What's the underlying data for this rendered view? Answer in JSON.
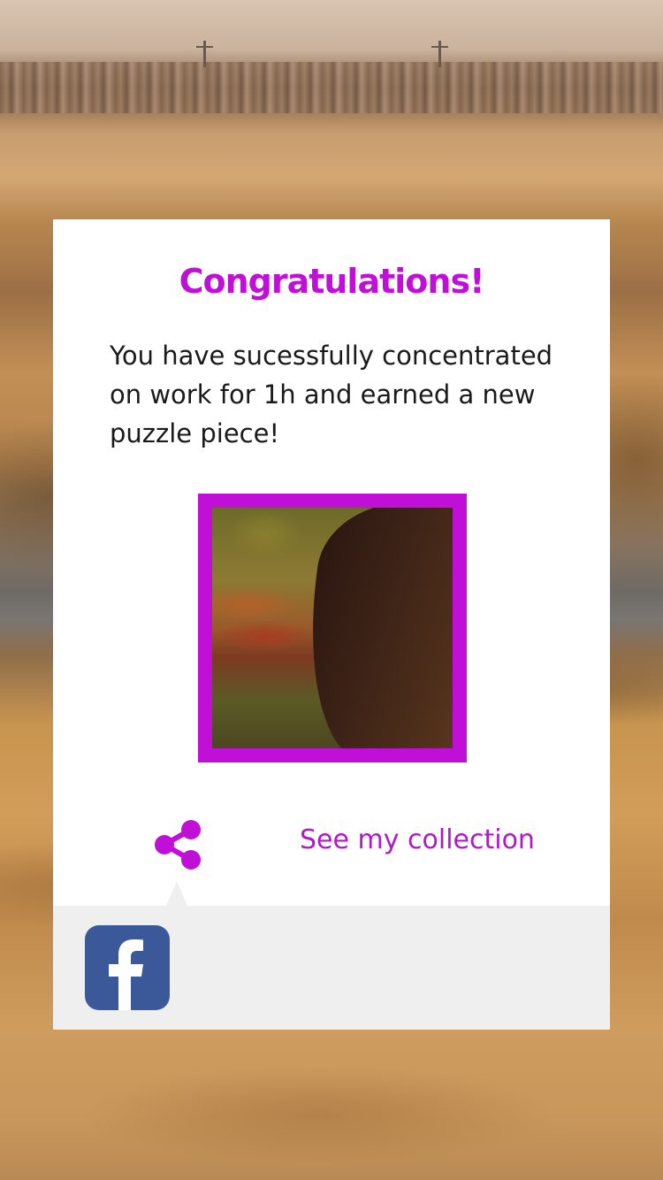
{
  "dialog": {
    "title": "Congratulations!",
    "message": "You have sucessfully concentrated on work for 1h and earned a new puzzle piece!",
    "see_collection_label": "See my collection",
    "share_icon": "share-icon",
    "social": [
      {
        "name": "facebook",
        "icon": "facebook-icon",
        "color": "#3b5999"
      }
    ]
  },
  "colors": {
    "accent": "#c010d8",
    "tray": "#efefef"
  }
}
